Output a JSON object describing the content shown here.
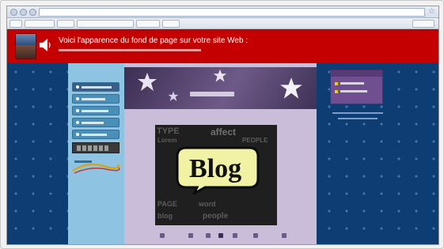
{
  "browser": {
    "icons": {
      "back": "back-arrow-icon",
      "forward": "forward-arrow-icon",
      "favorite": "star-icon"
    }
  },
  "toolbar": {
    "item_count": 7
  },
  "banner": {
    "title": "Voici l'apparence du fond de page sur votre site Web :",
    "background_color": "#c40000",
    "icons": {
      "sound": "speaker-icon"
    }
  },
  "sidebar_left": {
    "background_color": "#8ec3e2",
    "menu_item_count": 5
  },
  "main": {
    "image_text": "Blog",
    "background_words": [
      "TYPE",
      "affect",
      "Lorem",
      "PEOPLE",
      "PAGE",
      "word",
      "blog",
      "people"
    ]
  },
  "sidebar_right": {
    "background_color": "#6f4f8f"
  },
  "colors": {
    "page_background": "#0e3d74",
    "accent_purple": "#6f4f8f",
    "banner_red": "#c40000",
    "speech_bubble": "#f1f2a3"
  }
}
